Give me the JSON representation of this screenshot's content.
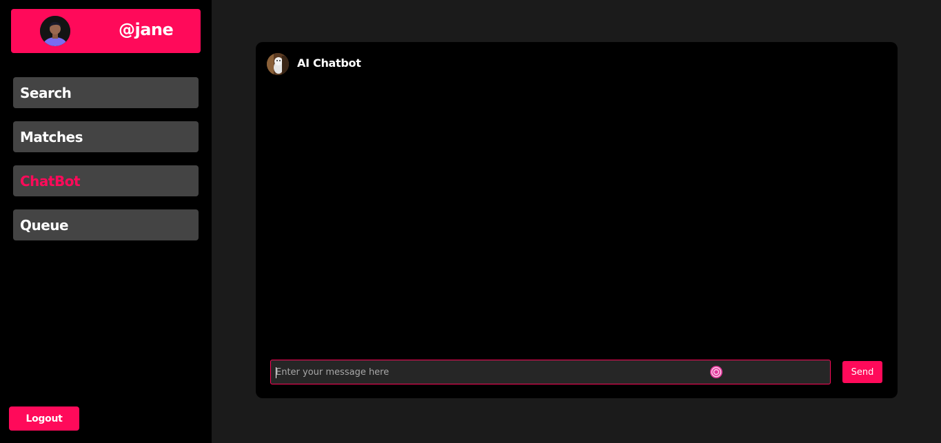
{
  "sidebar": {
    "profile": {
      "username": "@jane",
      "avatar_icon": "user-avatar-icon"
    },
    "nav": {
      "search_label": "Search",
      "matches_label": "Matches",
      "chatbot_label": "ChatBot",
      "queue_label": "Queue",
      "active": "ChatBot"
    },
    "logout_label": "Logout"
  },
  "chat": {
    "bot_name": "AI Chatbot",
    "bot_avatar_icon": "bot-avatar-icon",
    "messages": [],
    "input": {
      "value": "",
      "placeholder": "Enter your message here"
    },
    "send_label": "Send"
  },
  "colors": {
    "accent": "#ff0a5a",
    "sidebar_bg": "#000000",
    "main_bg": "#1b1b1b",
    "nav_item_bg": "#444444",
    "panel_bg": "#000000"
  }
}
